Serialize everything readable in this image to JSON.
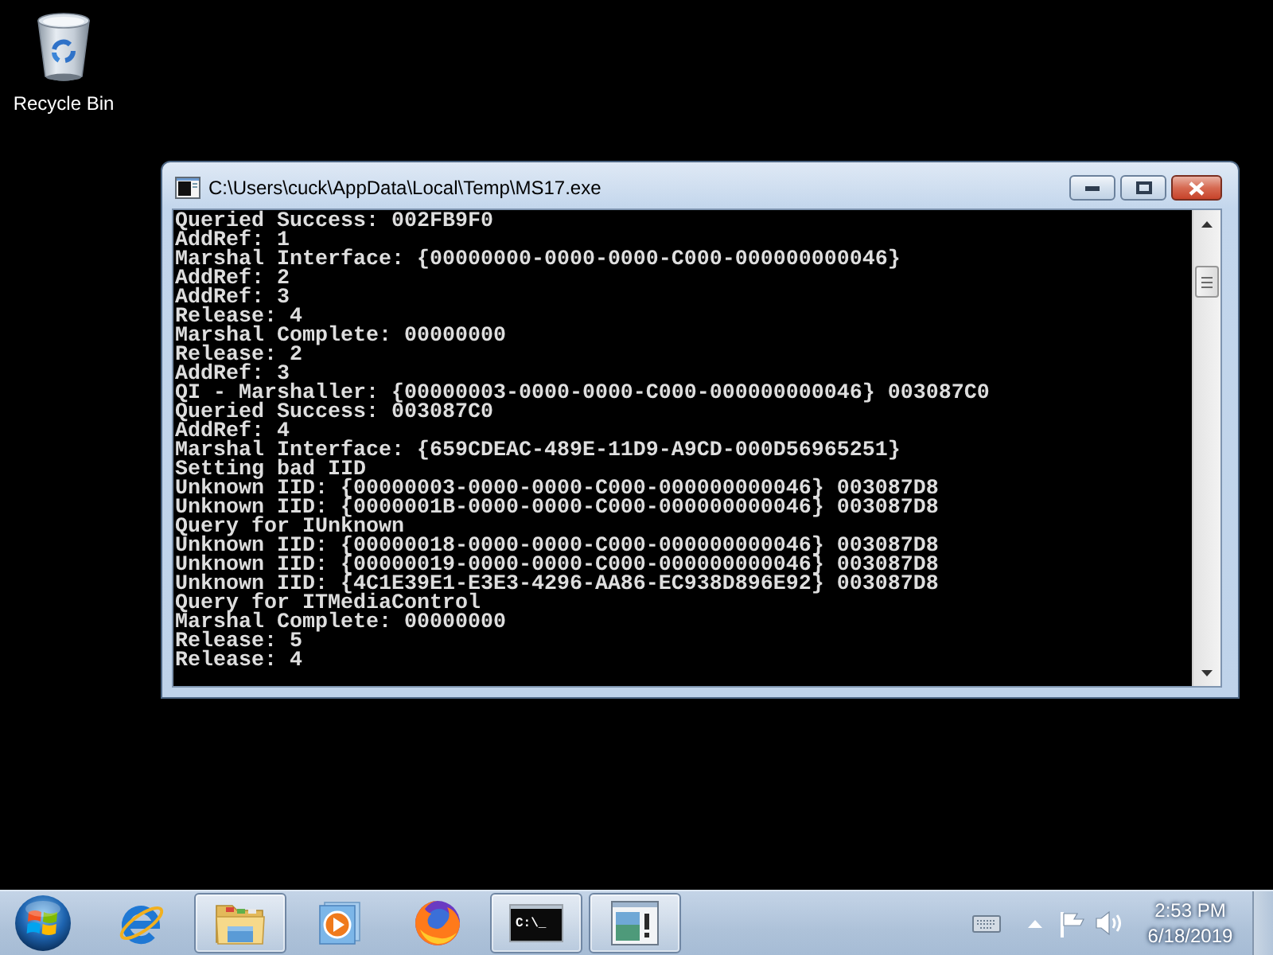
{
  "desktop": {
    "icons": [
      {
        "label": "Recycle Bin"
      }
    ]
  },
  "window": {
    "title": "C:\\Users\\cuck\\AppData\\Local\\Temp\\MS17.exe",
    "lines": [
      "Queried Success: 002FB9F0",
      "AddRef: 1",
      "Marshal Interface: {00000000-0000-0000-C000-000000000046}",
      "AddRef: 2",
      "AddRef: 3",
      "Release: 4",
      "Marshal Complete: 00000000",
      "Release: 2",
      "AddRef: 3",
      "QI - Marshaller: {00000003-0000-0000-C000-000000000046} 003087C0",
      "Queried Success: 003087C0",
      "AddRef: 4",
      "Marshal Interface: {659CDEAC-489E-11D9-A9CD-000D56965251}",
      "Setting bad IID",
      "Unknown IID: {00000003-0000-0000-C000-000000000046} 003087D8",
      "Unknown IID: {0000001B-0000-0000-C000-000000000046} 003087D8",
      "Query for IUnknown",
      "Unknown IID: {00000018-0000-0000-C000-000000000046} 003087D8",
      "Unknown IID: {00000019-0000-0000-C000-000000000046} 003087D8",
      "Unknown IID: {4C1E39E1-E3E3-4296-AA86-EC938D896E92} 003087D8",
      "Query for ITMediaControl",
      "Marshal Complete: 00000000",
      "Release: 5",
      "Release: 4"
    ]
  },
  "taskbar": {
    "items": [
      {
        "kind": "browser",
        "open": false
      },
      {
        "kind": "folder",
        "open": true
      },
      {
        "kind": "media",
        "open": false
      },
      {
        "kind": "fox",
        "open": false
      },
      {
        "kind": "console",
        "open": true,
        "icon_text": "C:\\_"
      },
      {
        "kind": "window",
        "open": true
      }
    ],
    "clock": {
      "time": "2:53 PM",
      "date": "6/18/2019"
    }
  }
}
